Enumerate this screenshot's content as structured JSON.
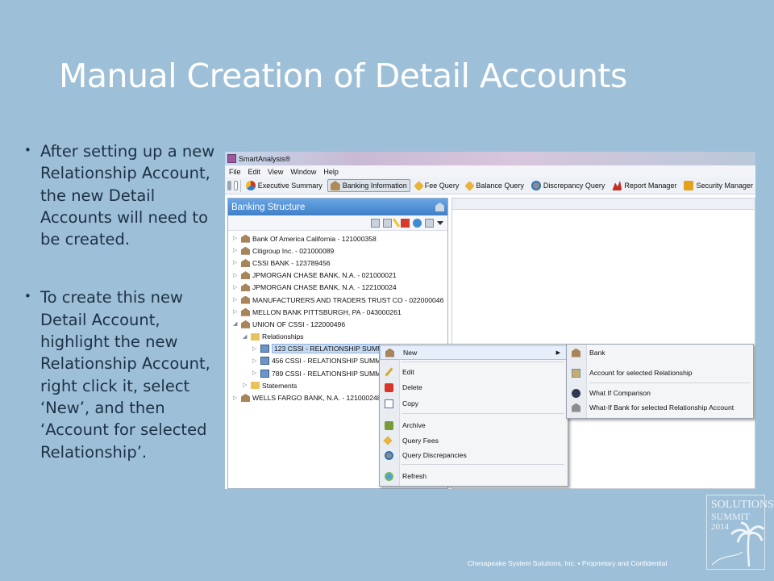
{
  "slide": {
    "title": "Manual Creation of Detail Accounts",
    "bullets": [
      "After setting up a new Relationship Account, the new Detail Accounts will need to be created.",
      "To create this new Detail Account, highlight the new Relationship Account, right click it, select ‘New’, and then ‘Account for selected Relationship’."
    ],
    "bullet_glyph": "•",
    "footer": "Chesapeake System Solutions, Inc.  ▪  Proprietary and Confidential",
    "logo": {
      "line1": "SOLUTIONS",
      "line2": "SUMMIT",
      "line3": "2014"
    }
  },
  "app": {
    "title": "SmartAnalysis®",
    "menu": [
      "File",
      "Edit",
      "View",
      "Window",
      "Help"
    ],
    "toolbar": [
      {
        "label": "Executive Summary",
        "icon": "pie-chart-icon",
        "active": false
      },
      {
        "label": "Banking Information",
        "icon": "bank-icon",
        "active": true
      },
      {
        "label": "Fee Query",
        "icon": "tag-icon",
        "active": false
      },
      {
        "label": "Balance Query",
        "icon": "tag-icon",
        "active": false
      },
      {
        "label": "Discrepancy Query",
        "icon": "discrepancy-icon",
        "active": false
      },
      {
        "label": "Report Manager",
        "icon": "report-icon",
        "active": false
      },
      {
        "label": "Security Manager",
        "icon": "lock-icon",
        "active": false
      }
    ],
    "panel_title": "Banking Structure",
    "tree": [
      {
        "label": "Bank Of America California - 121000358",
        "level": 0,
        "kind": "bank"
      },
      {
        "label": "Citigroup Inc. - 021000089",
        "level": 0,
        "kind": "bank"
      },
      {
        "label": "CSSI BANK - 123789456",
        "level": 0,
        "kind": "bank"
      },
      {
        "label": "JPMORGAN CHASE BANK, N.A. - 021000021",
        "level": 0,
        "kind": "bank"
      },
      {
        "label": "JPMORGAN CHASE BANK, N.A. - 122100024",
        "level": 0,
        "kind": "bank"
      },
      {
        "label": "MANUFACTURERS AND TRADERS TRUST CO - 022000046",
        "level": 0,
        "kind": "bank"
      },
      {
        "label": "MELLON BANK PITTSBURGH, PA - 043000261",
        "level": 0,
        "kind": "bank"
      },
      {
        "label": "UNION OF CSSI - 122000496",
        "level": 0,
        "kind": "bank",
        "expanded": true
      },
      {
        "label": "Relationships",
        "level": 1,
        "kind": "folder",
        "expanded": true
      },
      {
        "label": "123 CSSI - RELATIONSHIP SUMMA",
        "level": 2,
        "kind": "rel",
        "selected": true
      },
      {
        "label": "456 CSSI - RELATIONSHIP SUMMA",
        "level": 2,
        "kind": "rel"
      },
      {
        "label": "789 CSSI - RELATIONSHIP SUMMA",
        "level": 2,
        "kind": "rel"
      },
      {
        "label": "Statements",
        "level": 1,
        "kind": "folder"
      },
      {
        "label": "WELLS FARGO BANK, N.A. - 121000248",
        "level": 0,
        "kind": "bank"
      }
    ],
    "context_menu": {
      "new": "New",
      "edit": "Edit",
      "delete": "Delete",
      "copy": "Copy",
      "archive": "Archive",
      "query_fees": "Query Fees",
      "query_discrepancies": "Query Discrepancies",
      "refresh": "Refresh"
    },
    "submenu": {
      "bank": "Bank",
      "account_for_relationship": "Account for selected Relationship",
      "what_if_comparison": "What If Comparison",
      "what_if_bank": "What-If Bank for selected Relationship Account"
    }
  }
}
